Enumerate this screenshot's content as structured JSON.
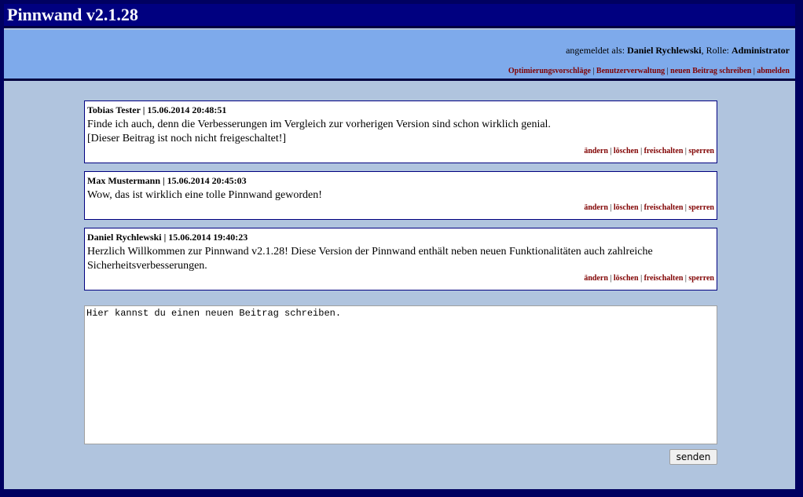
{
  "header": {
    "title": "Pinnwand v2.1.28"
  },
  "user": {
    "logged_in_label": "angemeldet als:",
    "name": "Daniel Rychlewski",
    "role_label": "Rolle:",
    "role": "Administrator"
  },
  "nav": {
    "items": [
      "Optimierungsvorschläge",
      "Benutzerverwaltung",
      "neuen Beitrag schreiben",
      "abmelden"
    ],
    "separator": "|"
  },
  "posts": [
    {
      "header": "Tobias Tester | 15.06.2014 20:48:51",
      "lines": [
        "Finde ich auch, denn die Verbesserungen im Vergleich zur vorherigen Version sind schon wirklich genial.",
        "[Dieser Beitrag ist noch nicht freigeschaltet!]"
      ]
    },
    {
      "header": "Max Mustermann | 15.06.2014 20:45:03",
      "lines": [
        "Wow, das ist wirklich eine tolle Pinnwand geworden!"
      ]
    },
    {
      "header": "Daniel Rychlewski | 15.06.2014 19:40:23",
      "lines": [
        "Herzlich Willkommen zur Pinnwand v2.1.28! Diese Version der Pinnwand enthält neben neuen Funktionalitäten auch zahlreiche Sicherheitsverbesserungen."
      ]
    }
  ],
  "post_actions": {
    "edit": "ändern",
    "delete": "löschen",
    "approve": "freischalten",
    "block": "sperren"
  },
  "composer": {
    "value": "Hier kannst du einen neuen Beitrag schreiben.",
    "send_label": "senden"
  },
  "colors": {
    "title_bar": "#000080",
    "user_bar": "#7eaaeb",
    "content_bg": "#b0c4de",
    "link": "#800000"
  }
}
